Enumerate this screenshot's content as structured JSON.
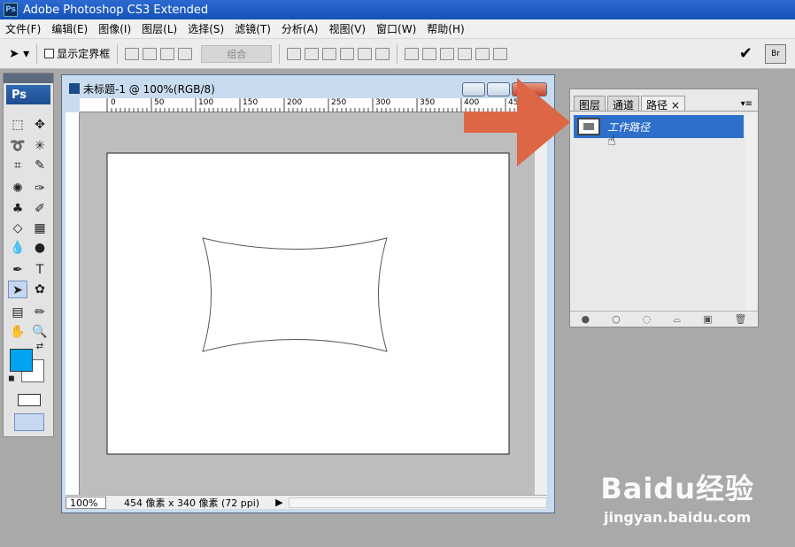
{
  "app": {
    "title": "Adobe Photoshop CS3 Extended",
    "logo": "Ps"
  },
  "menu": [
    "文件(F)",
    "编辑(E)",
    "图像(I)",
    "图层(L)",
    "选择(S)",
    "滤镜(T)",
    "分析(A)",
    "视图(V)",
    "窗口(W)",
    "帮助(H)"
  ],
  "options": {
    "show_bounding_box": "显示定界框",
    "combine": "组合"
  },
  "document": {
    "title": "未标题-1 @ 100%(RGB/8)",
    "zoom": "100%",
    "info": "454 像素 x 340 像素 (72 ppi)"
  },
  "ruler": {
    "h": [
      "0",
      "50",
      "100",
      "150",
      "200",
      "250",
      "300",
      "350",
      "400",
      "450"
    ]
  },
  "panel": {
    "tabs": [
      "图层",
      "通道",
      "路径"
    ],
    "active_tab": "路径",
    "path_name": "工作路径"
  },
  "watermark": {
    "main": "Baidu经验",
    "sub": "jingyan.baidu.com"
  },
  "colors": {
    "foreground": "#00a4ef",
    "selection": "#2f6fcc",
    "arrow": "#dd6644"
  }
}
